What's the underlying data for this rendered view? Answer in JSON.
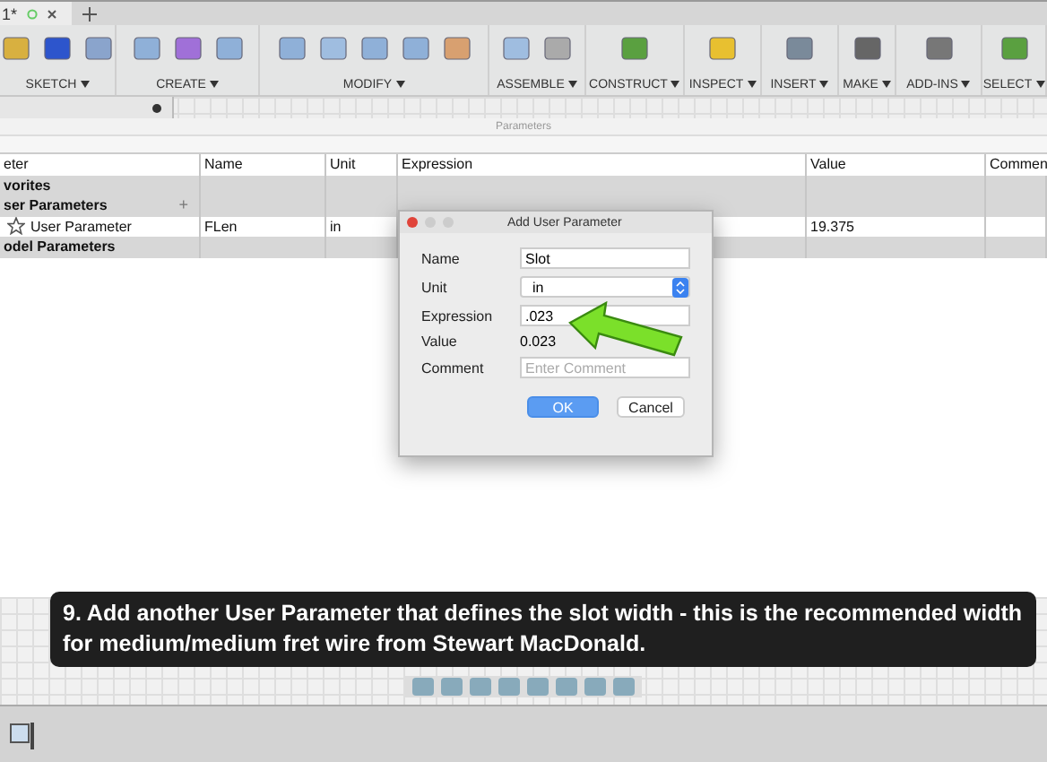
{
  "tab": {
    "label": "1*"
  },
  "toolbar": {
    "groups": [
      {
        "label": "SKETCH"
      },
      {
        "label": "CREATE"
      },
      {
        "label": "MODIFY"
      },
      {
        "label": "ASSEMBLE"
      },
      {
        "label": "CONSTRUCT"
      },
      {
        "label": "INSPECT"
      },
      {
        "label": "INSERT"
      },
      {
        "label": "MAKE"
      },
      {
        "label": "ADD-INS"
      },
      {
        "label": "SELECT"
      }
    ]
  },
  "panel": {
    "title": "Parameters"
  },
  "table": {
    "columns": [
      "eter",
      "Name",
      "Unit",
      "Expression",
      "Value",
      "Commen"
    ],
    "rows": [
      {
        "kind": "group",
        "label": "vorites"
      },
      {
        "kind": "group",
        "label": "ser Parameters",
        "add": "+"
      },
      {
        "kind": "param",
        "label": "User Parameter",
        "cells": [
          "FLen",
          "in",
          "",
          "19.375",
          ""
        ]
      },
      {
        "kind": "group",
        "label": "odel Parameters"
      }
    ]
  },
  "dialog": {
    "title": "Add User Parameter",
    "fields": [
      {
        "kind": "input",
        "label": "Name",
        "value": "Slot"
      },
      {
        "kind": "select",
        "label": "Unit",
        "value": "in"
      },
      {
        "kind": "input",
        "label": "Expression",
        "value": ".023"
      },
      {
        "kind": "text",
        "label": "Value",
        "value": "0.023"
      },
      {
        "kind": "input",
        "label": "Comment",
        "placeholder": "Enter Comment"
      }
    ],
    "buttons": [
      {
        "label": "OK",
        "selected": true
      },
      {
        "label": "Cancel",
        "selected": false
      }
    ]
  },
  "caption": "9. Add another User Parameter that defines the slot width - this is the recommended width for medium/medium fret wire from Stewart MacDonald."
}
